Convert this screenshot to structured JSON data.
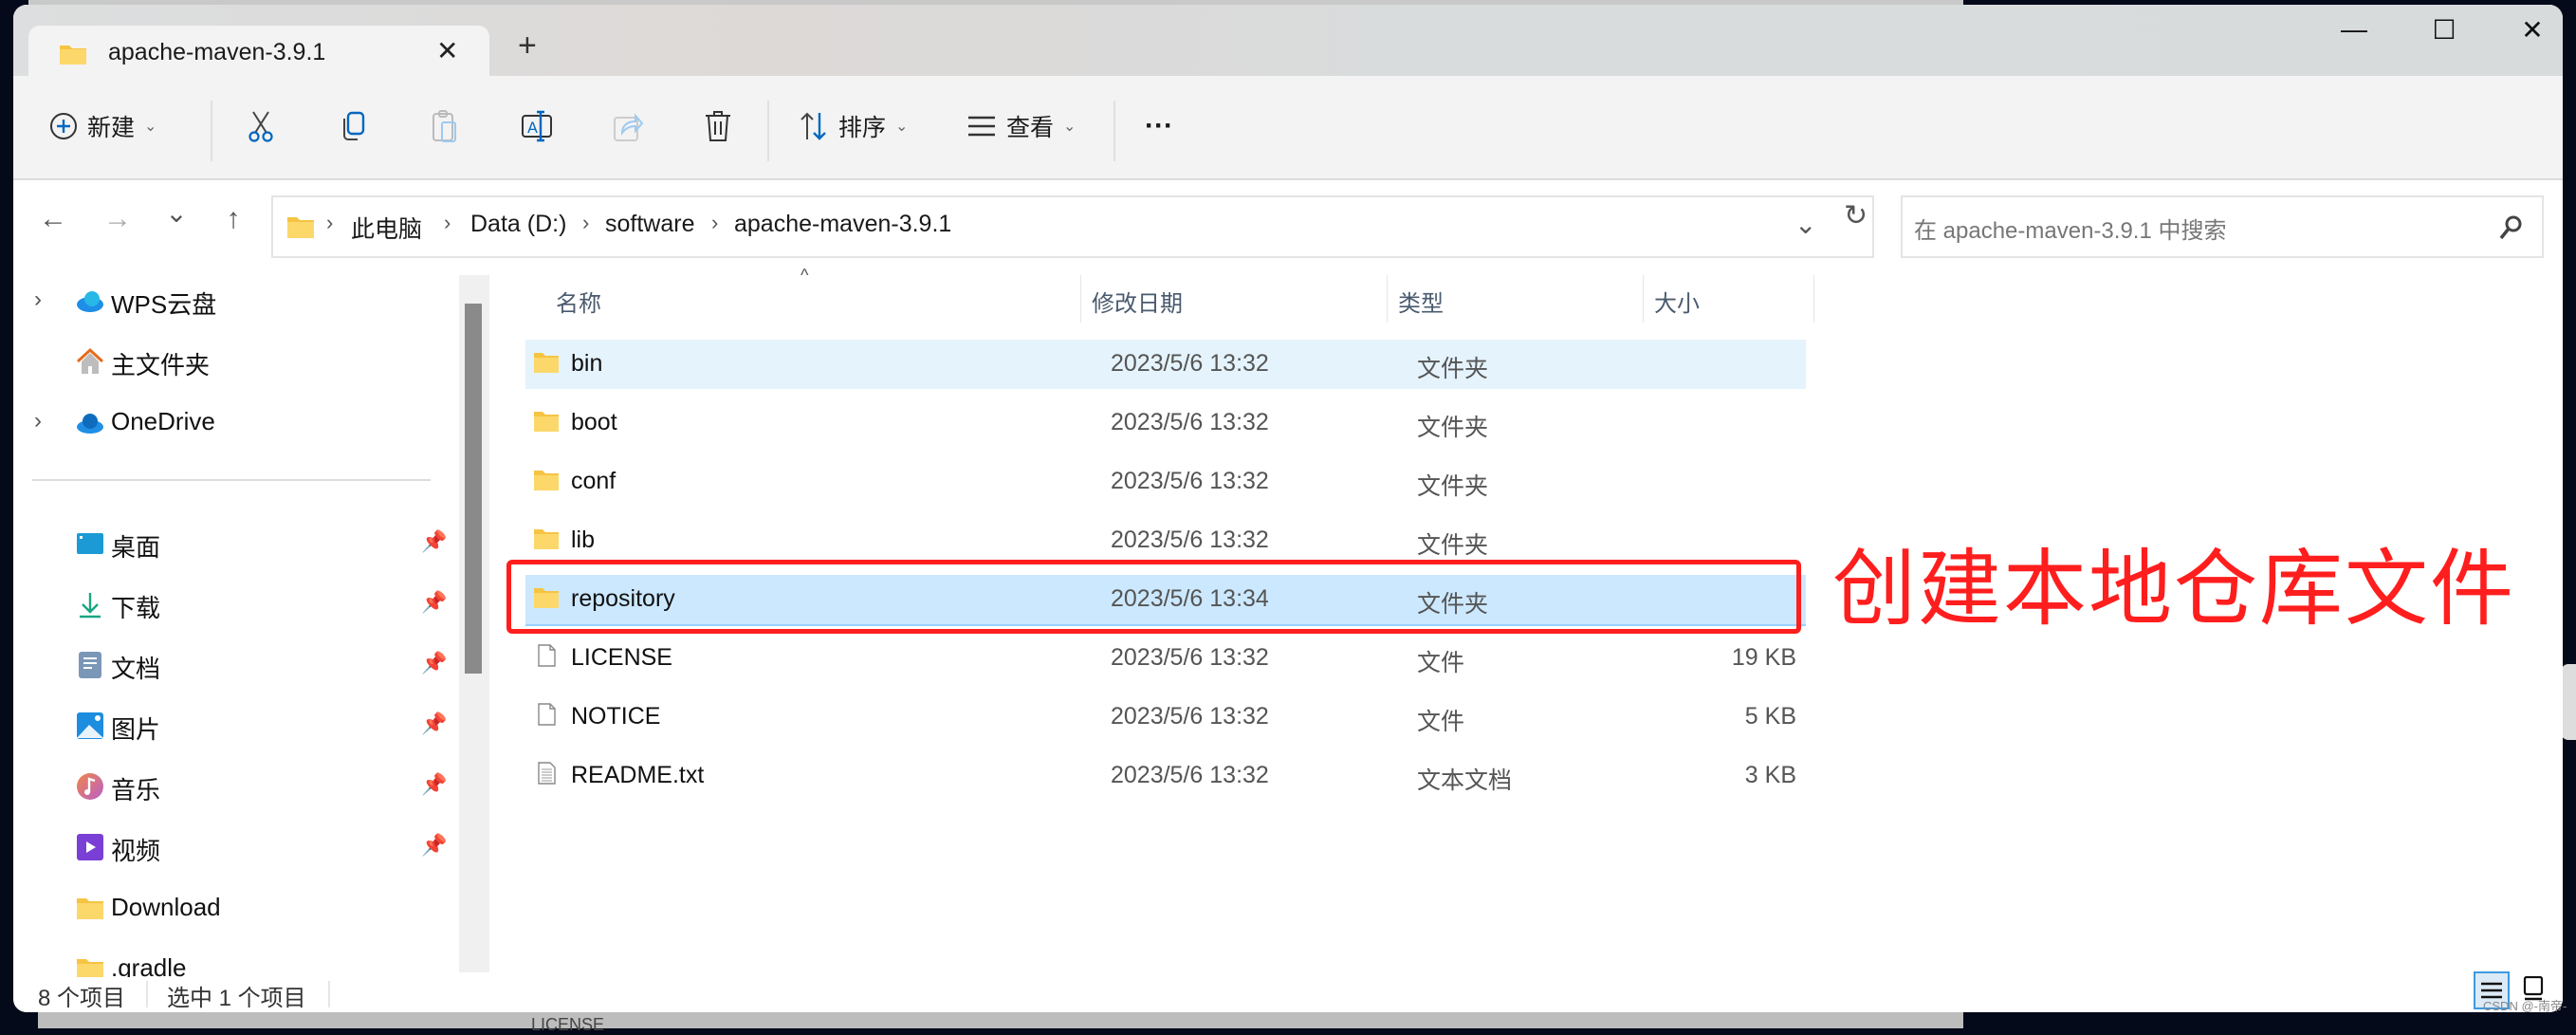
{
  "window": {
    "tab_title": "apache-maven-3.9.1",
    "tab_close": "✕",
    "new_tab": "+",
    "controls": {
      "minimize": "—",
      "maximize": "☐",
      "close": "✕"
    }
  },
  "toolbar": {
    "new_label": "新建",
    "sort_label": "排序",
    "view_label": "查看",
    "more_label": "···",
    "icons": [
      "new-icon",
      "cut-icon",
      "copy-icon",
      "paste-icon",
      "rename-icon",
      "share-icon",
      "delete-icon",
      "sort-icon",
      "view-icon",
      "more-icon"
    ]
  },
  "navigation": {
    "back": "←",
    "forward": "→",
    "recent": "⌄",
    "up": "↑",
    "breadcrumb": [
      "此电脑",
      "Data (D:)",
      "software",
      "apache-maven-3.9.1"
    ],
    "breadcrumb_sep": "›",
    "dropdown": "⌄",
    "refresh": "↻",
    "search_placeholder": "在 apache-maven-3.9.1 中搜索"
  },
  "sidebar": {
    "top_items": [
      {
        "label": "WPS云盘",
        "icon": "wps-cloud-icon",
        "expandable": true
      },
      {
        "label": "主文件夹",
        "icon": "home-icon",
        "expandable": false
      },
      {
        "label": "OneDrive",
        "icon": "onedrive-icon",
        "expandable": true
      }
    ],
    "quick_access": [
      {
        "label": "桌面",
        "icon": "desktop-icon",
        "pinned": true
      },
      {
        "label": "下载",
        "icon": "download-icon",
        "pinned": true
      },
      {
        "label": "文档",
        "icon": "documents-icon",
        "pinned": true
      },
      {
        "label": "图片",
        "icon": "pictures-icon",
        "pinned": true
      },
      {
        "label": "音乐",
        "icon": "music-icon",
        "pinned": true
      },
      {
        "label": "视频",
        "icon": "videos-icon",
        "pinned": true
      },
      {
        "label": "Download",
        "icon": "folder-icon",
        "pinned": false
      },
      {
        "label": ".gradle",
        "icon": "folder-icon",
        "pinned": false
      }
    ],
    "arrow": "›",
    "pin": "📌"
  },
  "file_list": {
    "columns": [
      "名称",
      "修改日期",
      "类型",
      "大小"
    ],
    "sort_indicator": "^",
    "rows": [
      {
        "name": "bin",
        "date": "2023/5/6 13:32",
        "type": "文件夹",
        "size": "",
        "kind": "folder",
        "state": "hover"
      },
      {
        "name": "boot",
        "date": "2023/5/6 13:32",
        "type": "文件夹",
        "size": "",
        "kind": "folder",
        "state": ""
      },
      {
        "name": "conf",
        "date": "2023/5/6 13:32",
        "type": "文件夹",
        "size": "",
        "kind": "folder",
        "state": ""
      },
      {
        "name": "lib",
        "date": "2023/5/6 13:32",
        "type": "文件夹",
        "size": "",
        "kind": "folder",
        "state": ""
      },
      {
        "name": "repository",
        "date": "2023/5/6 13:34",
        "type": "文件夹",
        "size": "",
        "kind": "folder",
        "state": "selected"
      },
      {
        "name": "LICENSE",
        "date": "2023/5/6 13:32",
        "type": "文件",
        "size": "19 KB",
        "kind": "file",
        "state": ""
      },
      {
        "name": "NOTICE",
        "date": "2023/5/6 13:32",
        "type": "文件",
        "size": "5 KB",
        "kind": "file",
        "state": ""
      },
      {
        "name": "README.txt",
        "date": "2023/5/6 13:32",
        "type": "文本文档",
        "size": "3 KB",
        "kind": "text",
        "state": ""
      }
    ]
  },
  "annotation": {
    "text": "创建本地仓库文件",
    "color": "#ff1e1e"
  },
  "status": {
    "item_count": "8 个项目",
    "selected_count": "选中 1 个项目"
  },
  "background_text": {
    "bottom_file": "LICENSE"
  },
  "watermark": "CSDN @-南帝-",
  "colors": {
    "selection": "#cce8ff",
    "hover": "#e5f3fd",
    "accent": "#0067c0",
    "folder": "#f8c84a"
  }
}
